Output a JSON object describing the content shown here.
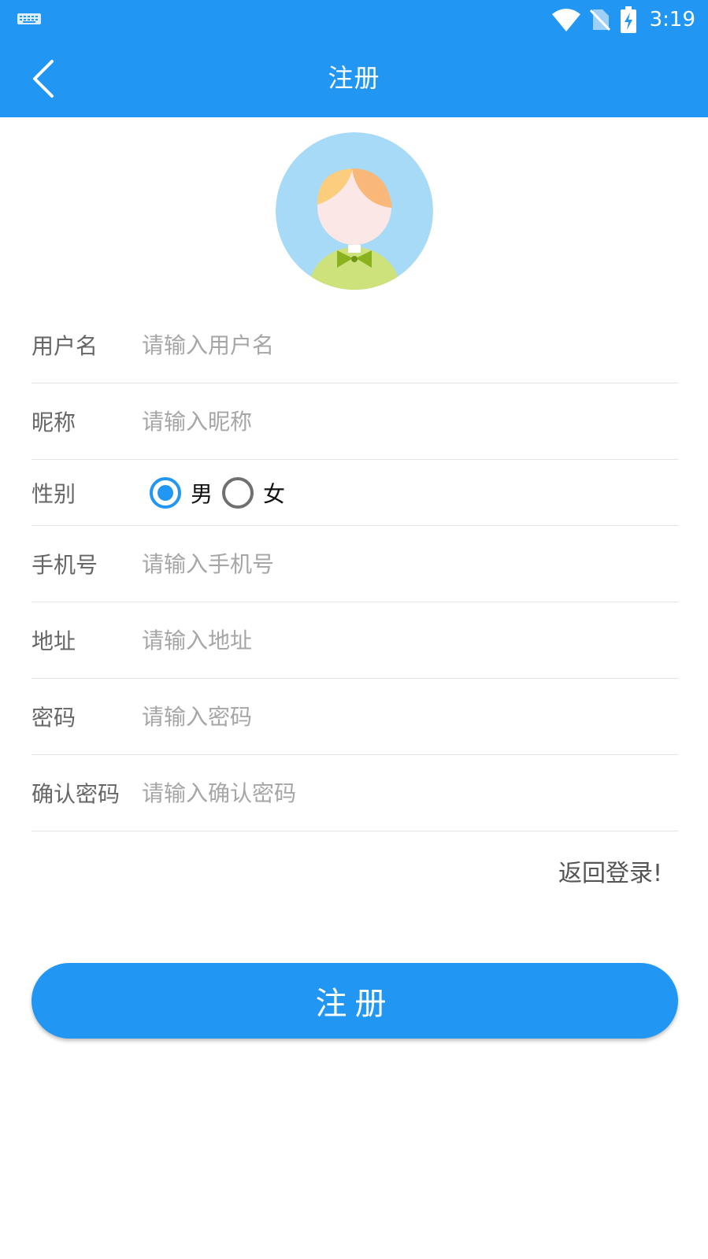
{
  "status_bar": {
    "time": "3:19"
  },
  "toolbar": {
    "title": "注册"
  },
  "form": {
    "username": {
      "label": "用户名",
      "placeholder": "请输入用户名",
      "value": ""
    },
    "nickname": {
      "label": "昵称",
      "placeholder": "请输入昵称",
      "value": ""
    },
    "gender": {
      "label": "性别",
      "options": [
        "男",
        "女"
      ],
      "selected": "男"
    },
    "phone": {
      "label": "手机号",
      "placeholder": "请输入手机号",
      "value": ""
    },
    "address": {
      "label": "地址",
      "placeholder": "请输入地址",
      "value": ""
    },
    "password": {
      "label": "密码",
      "placeholder": "请输入密码",
      "value": ""
    },
    "confirm_password": {
      "label": "确认密码",
      "placeholder": "请输入确认密码",
      "value": ""
    }
  },
  "back_to_login": "返回登录!",
  "register_button": "注册",
  "colors": {
    "primary": "#2196f3",
    "label": "#666666",
    "placeholder": "#a6a6a6",
    "divider": "#e4e4e4"
  }
}
